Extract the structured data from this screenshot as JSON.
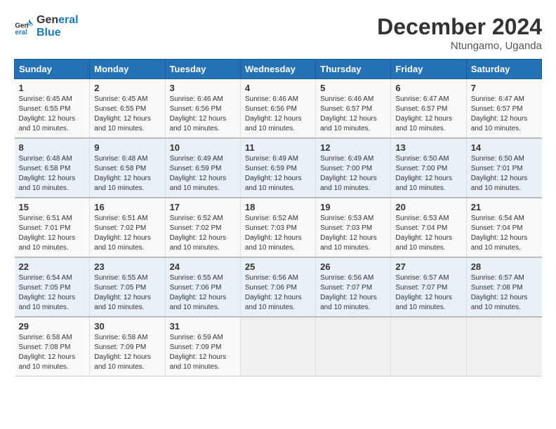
{
  "logo": {
    "line1": "General",
    "line2": "Blue"
  },
  "title": "December 2024",
  "location": "Ntungamo, Uganda",
  "days_of_week": [
    "Sunday",
    "Monday",
    "Tuesday",
    "Wednesday",
    "Thursday",
    "Friday",
    "Saturday"
  ],
  "weeks": [
    [
      {
        "day": "1",
        "sunrise": "6:45 AM",
        "sunset": "6:55 PM",
        "daylight": "12 hours and 10 minutes."
      },
      {
        "day": "2",
        "sunrise": "6:45 AM",
        "sunset": "6:55 PM",
        "daylight": "12 hours and 10 minutes."
      },
      {
        "day": "3",
        "sunrise": "6:46 AM",
        "sunset": "6:56 PM",
        "daylight": "12 hours and 10 minutes."
      },
      {
        "day": "4",
        "sunrise": "6:46 AM",
        "sunset": "6:56 PM",
        "daylight": "12 hours and 10 minutes."
      },
      {
        "day": "5",
        "sunrise": "6:46 AM",
        "sunset": "6:57 PM",
        "daylight": "12 hours and 10 minutes."
      },
      {
        "day": "6",
        "sunrise": "6:47 AM",
        "sunset": "6:57 PM",
        "daylight": "12 hours and 10 minutes."
      },
      {
        "day": "7",
        "sunrise": "6:47 AM",
        "sunset": "6:57 PM",
        "daylight": "12 hours and 10 minutes."
      }
    ],
    [
      {
        "day": "8",
        "sunrise": "6:48 AM",
        "sunset": "6:58 PM",
        "daylight": "12 hours and 10 minutes."
      },
      {
        "day": "9",
        "sunrise": "6:48 AM",
        "sunset": "6:58 PM",
        "daylight": "12 hours and 10 minutes."
      },
      {
        "day": "10",
        "sunrise": "6:49 AM",
        "sunset": "6:59 PM",
        "daylight": "12 hours and 10 minutes."
      },
      {
        "day": "11",
        "sunrise": "6:49 AM",
        "sunset": "6:59 PM",
        "daylight": "12 hours and 10 minutes."
      },
      {
        "day": "12",
        "sunrise": "6:49 AM",
        "sunset": "7:00 PM",
        "daylight": "12 hours and 10 minutes."
      },
      {
        "day": "13",
        "sunrise": "6:50 AM",
        "sunset": "7:00 PM",
        "daylight": "12 hours and 10 minutes."
      },
      {
        "day": "14",
        "sunrise": "6:50 AM",
        "sunset": "7:01 PM",
        "daylight": "12 hours and 10 minutes."
      }
    ],
    [
      {
        "day": "15",
        "sunrise": "6:51 AM",
        "sunset": "7:01 PM",
        "daylight": "12 hours and 10 minutes."
      },
      {
        "day": "16",
        "sunrise": "6:51 AM",
        "sunset": "7:02 PM",
        "daylight": "12 hours and 10 minutes."
      },
      {
        "day": "17",
        "sunrise": "6:52 AM",
        "sunset": "7:02 PM",
        "daylight": "12 hours and 10 minutes."
      },
      {
        "day": "18",
        "sunrise": "6:52 AM",
        "sunset": "7:03 PM",
        "daylight": "12 hours and 10 minutes."
      },
      {
        "day": "19",
        "sunrise": "6:53 AM",
        "sunset": "7:03 PM",
        "daylight": "12 hours and 10 minutes."
      },
      {
        "day": "20",
        "sunrise": "6:53 AM",
        "sunset": "7:04 PM",
        "daylight": "12 hours and 10 minutes."
      },
      {
        "day": "21",
        "sunrise": "6:54 AM",
        "sunset": "7:04 PM",
        "daylight": "12 hours and 10 minutes."
      }
    ],
    [
      {
        "day": "22",
        "sunrise": "6:54 AM",
        "sunset": "7:05 PM",
        "daylight": "12 hours and 10 minutes."
      },
      {
        "day": "23",
        "sunrise": "6:55 AM",
        "sunset": "7:05 PM",
        "daylight": "12 hours and 10 minutes."
      },
      {
        "day": "24",
        "sunrise": "6:55 AM",
        "sunset": "7:06 PM",
        "daylight": "12 hours and 10 minutes."
      },
      {
        "day": "25",
        "sunrise": "6:56 AM",
        "sunset": "7:06 PM",
        "daylight": "12 hours and 10 minutes."
      },
      {
        "day": "26",
        "sunrise": "6:56 AM",
        "sunset": "7:07 PM",
        "daylight": "12 hours and 10 minutes."
      },
      {
        "day": "27",
        "sunrise": "6:57 AM",
        "sunset": "7:07 PM",
        "daylight": "12 hours and 10 minutes."
      },
      {
        "day": "28",
        "sunrise": "6:57 AM",
        "sunset": "7:08 PM",
        "daylight": "12 hours and 10 minutes."
      }
    ],
    [
      {
        "day": "29",
        "sunrise": "6:58 AM",
        "sunset": "7:08 PM",
        "daylight": "12 hours and 10 minutes."
      },
      {
        "day": "30",
        "sunrise": "6:58 AM",
        "sunset": "7:09 PM",
        "daylight": "12 hours and 10 minutes."
      },
      {
        "day": "31",
        "sunrise": "6:59 AM",
        "sunset": "7:09 PM",
        "daylight": "12 hours and 10 minutes."
      },
      null,
      null,
      null,
      null
    ]
  ]
}
